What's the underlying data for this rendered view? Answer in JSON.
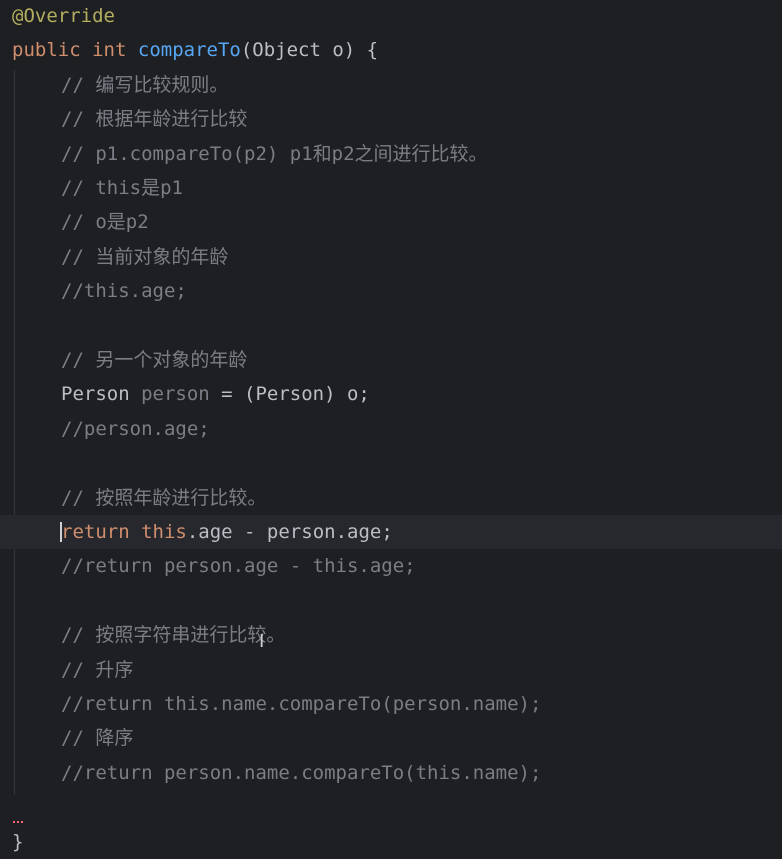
{
  "editor": {
    "lines": [
      {
        "parts": [
          {
            "t": "@Override",
            "c": "ann"
          }
        ]
      },
      {
        "parts": [
          {
            "t": "public",
            "c": "kw"
          },
          {
            "t": " "
          },
          {
            "t": "int",
            "c": "kw"
          },
          {
            "t": " "
          },
          {
            "t": "compareTo",
            "c": "fn"
          },
          {
            "t": "(Object o) {"
          }
        ]
      },
      {
        "parts": [
          {
            "t": "// 编写比较规则。",
            "c": "cmt"
          }
        ]
      },
      {
        "parts": [
          {
            "t": "// 根据年龄进行比较",
            "c": "cmt"
          }
        ]
      },
      {
        "parts": [
          {
            "t": "// p1.compareTo(p2) p1和p2之间进行比较。",
            "c": "cmt"
          }
        ]
      },
      {
        "parts": [
          {
            "t": "// this是p1",
            "c": "cmt"
          }
        ]
      },
      {
        "parts": [
          {
            "t": "// o是p2",
            "c": "cmt"
          }
        ]
      },
      {
        "parts": [
          {
            "t": "// 当前对象的年龄",
            "c": "cmt"
          }
        ]
      },
      {
        "parts": [
          {
            "t": "//this.age;",
            "c": "cmt"
          }
        ]
      },
      {
        "parts": []
      },
      {
        "parts": [
          {
            "t": "// 另一个对象的年龄",
            "c": "cmt"
          }
        ]
      },
      {
        "parts": [
          {
            "t": "Person "
          },
          {
            "t": "person",
            "c": "var-unused"
          },
          {
            "t": " = (Person) o;"
          }
        ]
      },
      {
        "parts": [
          {
            "t": "//person.age;",
            "c": "cmt"
          }
        ]
      },
      {
        "parts": []
      },
      {
        "parts": [
          {
            "t": "// 按照年龄进行比较。",
            "c": "cmt"
          }
        ]
      },
      {
        "parts": [
          {
            "t": "return",
            "c": "kw"
          },
          {
            "t": " "
          },
          {
            "t": "this",
            "c": "kw"
          },
          {
            "t": ".age - person.age;"
          }
        ]
      },
      {
        "parts": [
          {
            "t": "//return person.age - this.age;",
            "c": "cmt"
          }
        ]
      },
      {
        "parts": []
      },
      {
        "parts": [
          {
            "t": "// 按照字符串进行比较。",
            "c": "cmt"
          }
        ]
      },
      {
        "parts": [
          {
            "t": "// 升序",
            "c": "cmt"
          }
        ]
      },
      {
        "parts": [
          {
            "t": "//return this.name.compareTo(person.name);",
            "c": "cmt"
          }
        ]
      },
      {
        "parts": [
          {
            "t": "// 降序",
            "c": "cmt"
          }
        ]
      },
      {
        "parts": [
          {
            "t": "//return person.name.compareTo(this.name);",
            "c": "cmt"
          }
        ]
      },
      {
        "parts": []
      },
      {
        "parts": [
          {
            "t": "}"
          }
        ]
      }
    ],
    "current_line": 16,
    "colors": {
      "background": "#1e1f22",
      "text": "#bcbec4",
      "keyword": "#cf8e6d",
      "annotation": "#b3ae60",
      "method": "#56a8f5",
      "comment": "#7a7e85",
      "current_line": "#26282e"
    },
    "icons": [
      "text-cursor-icon"
    ]
  }
}
